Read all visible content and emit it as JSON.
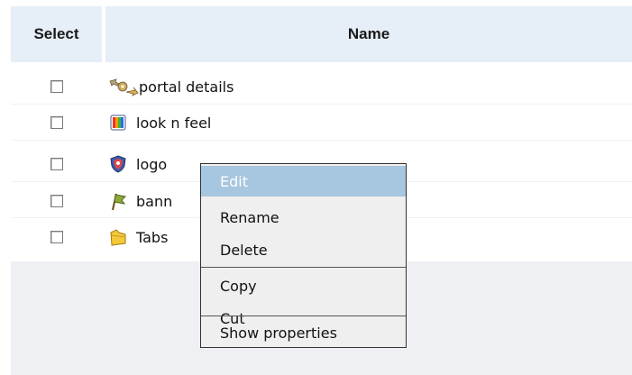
{
  "table": {
    "headers": {
      "select": "Select",
      "name": "Name"
    },
    "rows": [
      {
        "name": "portal details",
        "icon": "gears-arrows-icon",
        "checked": false
      },
      {
        "name": "look n feel",
        "icon": "color-palette-icon",
        "checked": false
      },
      {
        "name": "logo",
        "icon": "shield-logo-icon",
        "checked": false
      },
      {
        "name": "bann",
        "icon": "flag-banner-icon",
        "checked": false
      },
      {
        "name": "Tabs",
        "icon": "folder-tabs-icon",
        "checked": false
      }
    ]
  },
  "context_menu": {
    "items": [
      {
        "label": "Edit",
        "highlighted": true
      },
      {
        "label": "Rename",
        "highlighted": false
      },
      {
        "label": "Delete",
        "highlighted": false
      },
      {
        "label": "Copy",
        "highlighted": false
      },
      {
        "label": "Cut",
        "highlighted": false
      },
      {
        "label": "Show properties",
        "highlighted": false
      }
    ]
  },
  "colors": {
    "header_bg": "#e6eef7",
    "menu_highlight": "#a7c6df",
    "menu_bg": "#efefef",
    "empty_area_bg": "#eef0f3"
  }
}
